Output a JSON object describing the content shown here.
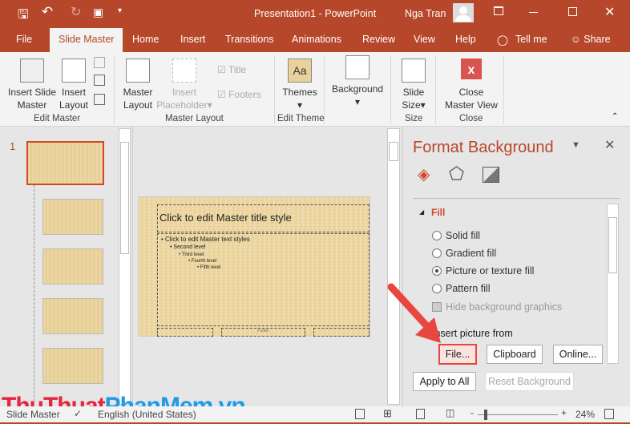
{
  "titlebar": {
    "title": "Presentation1  -  PowerPoint",
    "user": "Nga Tran"
  },
  "tabs": [
    "File",
    "Slide Master",
    "Home",
    "Insert",
    "Transitions",
    "Animations",
    "Review",
    "View",
    "Help",
    "Tell me",
    "Share"
  ],
  "ribbon": {
    "insert_slide_master": [
      "Insert Slide",
      "Master"
    ],
    "insert_layout": [
      "Insert",
      "Layout"
    ],
    "master_layout": [
      "Master",
      "Layout"
    ],
    "insert_placeholder": [
      "Insert",
      "Placeholder"
    ],
    "title_check": "Title",
    "footers_check": "Footers",
    "themes": "Themes",
    "background": "Background",
    "slide_size": [
      "Slide",
      "Size"
    ],
    "close_master_view": [
      "Close",
      "Master View"
    ],
    "groups": [
      "Edit Master",
      "Master Layout",
      "Edit Theme",
      "Size",
      "Close"
    ]
  },
  "thumbs": {
    "selected_number": "1"
  },
  "slide": {
    "title": "Click to edit Master title style",
    "levels": [
      "Click to edit Master text styles",
      "Second level",
      "Third level",
      "Fourth level",
      "Fifth level"
    ],
    "footer": "Footer"
  },
  "pane": {
    "title": "Format Background",
    "section": "Fill",
    "options": [
      {
        "label": "Solid fill",
        "selected": false
      },
      {
        "label": "Gradient fill",
        "selected": false
      },
      {
        "label": "Picture or texture fill",
        "selected": true
      },
      {
        "label": "Pattern fill",
        "selected": false
      }
    ],
    "hide_bg": "Hide background graphics",
    "insert_from": "Insert picture from",
    "file": "File...",
    "clipboard": "Clipboard",
    "online": "Online...",
    "apply_all": "Apply to All",
    "reset": "Reset Background"
  },
  "status": {
    "view": "Slide Master",
    "language": "English (United States)",
    "zoom": "24%"
  },
  "watermark": {
    "part1": "ThuThuat",
    "part2": "PhanMem",
    "part3": ".vn"
  },
  "colors": {
    "accent": "#b7472a",
    "arrow": "#e8473f"
  }
}
